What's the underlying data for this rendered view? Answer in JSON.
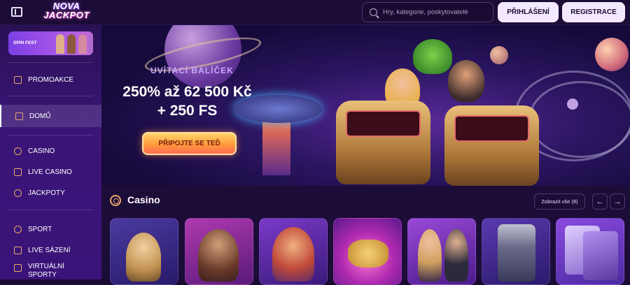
{
  "header": {
    "logo_line1": "NOVA",
    "logo_line2": "JACKPOT",
    "search_placeholder": "Hry, kategorie, poskytovatelé",
    "login_label": "PŘIHLÁŠENÍ",
    "register_label": "REGISTRACE"
  },
  "sidebar": {
    "promo_card_label": "SPIN FEST",
    "items": [
      {
        "label": "PROMOAKCE",
        "icon": "gift-icon"
      },
      {
        "label": "DOMŮ",
        "icon": "home-icon",
        "active": true
      },
      {
        "label": "CASINO",
        "icon": "chip-icon"
      },
      {
        "label": "LIVE CASINO",
        "icon": "spade-icon"
      },
      {
        "label": "JACKPOTY",
        "icon": "seven-icon"
      },
      {
        "label": "SPORT",
        "icon": "ball-icon"
      },
      {
        "label": "LIVE SÁZENÍ",
        "icon": "live-icon"
      },
      {
        "label": "VIRTUÁLNÍ",
        "label2": "SPORTY",
        "icon": "virtual-icon"
      }
    ]
  },
  "hero": {
    "subtitle": "UVÍTACÍ BALÍČEK",
    "title_line1": "250% až 62 500 Kč",
    "title_line2": "+ 250 FS",
    "cta_label": "PŘIPOJTE SE TEĎ"
  },
  "casino_section": {
    "title": "Casino",
    "show_all_label": "Zobrazit vše (8)",
    "prev_label": "←",
    "next_label": "→",
    "games": [
      {
        "name": "game-1",
        "bg": "#3b1f7a"
      },
      {
        "name": "game-2",
        "bg": "#7a2a8a"
      },
      {
        "name": "game-3",
        "bg": "#5a2a9a"
      },
      {
        "name": "game-4",
        "bg": "#a02aa8"
      },
      {
        "name": "game-5",
        "bg": "#6a2a9a"
      },
      {
        "name": "game-6",
        "bg": "#4a1f8a"
      },
      {
        "name": "game-7",
        "bg": "#7a3ac8"
      }
    ]
  },
  "colors": {
    "background": "#1a0b33",
    "accent_orange": "#e7a86a",
    "cta": "#ff9a3a",
    "button_light": "#f3e9ff"
  }
}
